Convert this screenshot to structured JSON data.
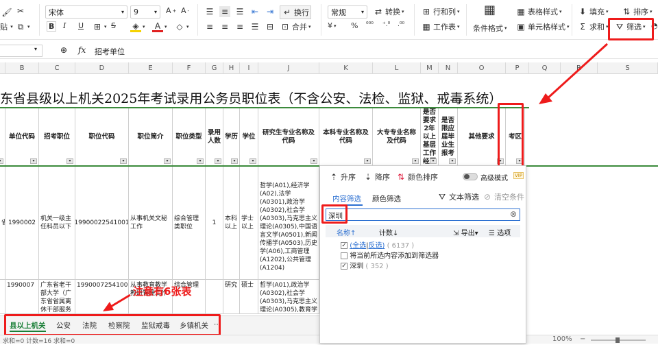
{
  "toolbar": {
    "font_name": "宋体",
    "font_size": "9",
    "wrap_label": "换行",
    "merge_label": "合并",
    "number_format": "常规",
    "convert_label": "转换",
    "rows_cols_label": "行和列",
    "worksheet_label": "工作表",
    "cond_format_label": "条件格式",
    "table_style_label": "表格样式",
    "cell_style_label": "单元格样式",
    "fill_label": "填充",
    "sort_label": "排序",
    "sum_label": "求和",
    "filter_label": "筛选",
    "paste_label": "贴"
  },
  "formula_bar": {
    "fx_label": "fx",
    "content": "招考单位"
  },
  "columns": [
    "B",
    "C",
    "D",
    "E",
    "F",
    "G",
    "H",
    "I",
    "J",
    "K",
    "L",
    "M",
    "N",
    "O",
    "P",
    "Q",
    "R",
    "S"
  ],
  "title": "东省县级以上机关2025年考试录用公务员职位表（不含公安、法检、监狱、戒毒系统）",
  "headers": {
    "a": "",
    "b": "单位代码",
    "c": "招考职位",
    "d": "职位代码",
    "e": "职位简介",
    "f": "职位类型",
    "g": "录用人数",
    "h": "学历",
    "i": "学位",
    "j": "研究生专业名称及代码",
    "k": "本科专业名称及代码",
    "l": "大专专业名称及代码",
    "m": "是否要求2年以上基层工作经历",
    "n": "是否限应届毕业生报考",
    "o": "其他要求",
    "p": "考区"
  },
  "rows": [
    {
      "a": "省",
      "b": "1990002",
      "c": "机关一级主任科员以下",
      "d": "19900022541001",
      "e": "从事机关文秘工作",
      "f": "综合管理类职位",
      "g": "1",
      "h": "本科以上",
      "i": "学士以上",
      "j": "哲学(A01),经济学(A02),法学(A0301),政治学(A0302),社会学(A0303),马克思主义理论(A0305),中国语言文学(A0501),新闻传播学(A0503),历史学(A06),工商管理(A1202),公共管理(A1204)"
    },
    {
      "a": "",
      "b": "1990007",
      "c": "广东省老干部大学（广东省省属离休干部服务",
      "d": "19900072541001",
      "e": "从事教育教学教研管理工作",
      "f": "综合管理",
      "g": "",
      "h": "研究",
      "i": "硕士",
      "j": "哲学(A01),政治学(A0302),社会学(A0303),马克思主义理论(A0305),教育学(A0401),心理学"
    }
  ],
  "note": "注意有6张表",
  "sheet_tabs": [
    "县以上机关",
    "公安",
    "法院",
    "检察院",
    "监狱戒毒",
    "乡镇机关"
  ],
  "active_sheet": "县以上机关",
  "status_bar": {
    "left": "求和=0 计数=16 求和=0",
    "zoom": "100%"
  },
  "filter_panel": {
    "sort_asc": "升序",
    "sort_desc": "降序",
    "color_sort": "颜色排序",
    "advanced_mode": "高级模式",
    "vip": "VIP",
    "tab_content": "内容筛选",
    "tab_color": "颜色筛选",
    "text_filter": "文本筛选",
    "clear_condition": "清空条件",
    "search_value": "深圳",
    "col_name": "名称",
    "col_count": "计数",
    "export_label": "导出",
    "options_label": "选项",
    "select_all": "(全选",
    "invert": "反选)",
    "select_all_count": "( 6137 )",
    "add_to_filter": "将当前所选内容添加到筛选器",
    "item_label": "深圳",
    "item_count": "( 352 )"
  },
  "colors": {
    "accent_red": "#ee1b1b",
    "green_border": "#3b8a3b",
    "active_tab": "#1a7f37"
  }
}
